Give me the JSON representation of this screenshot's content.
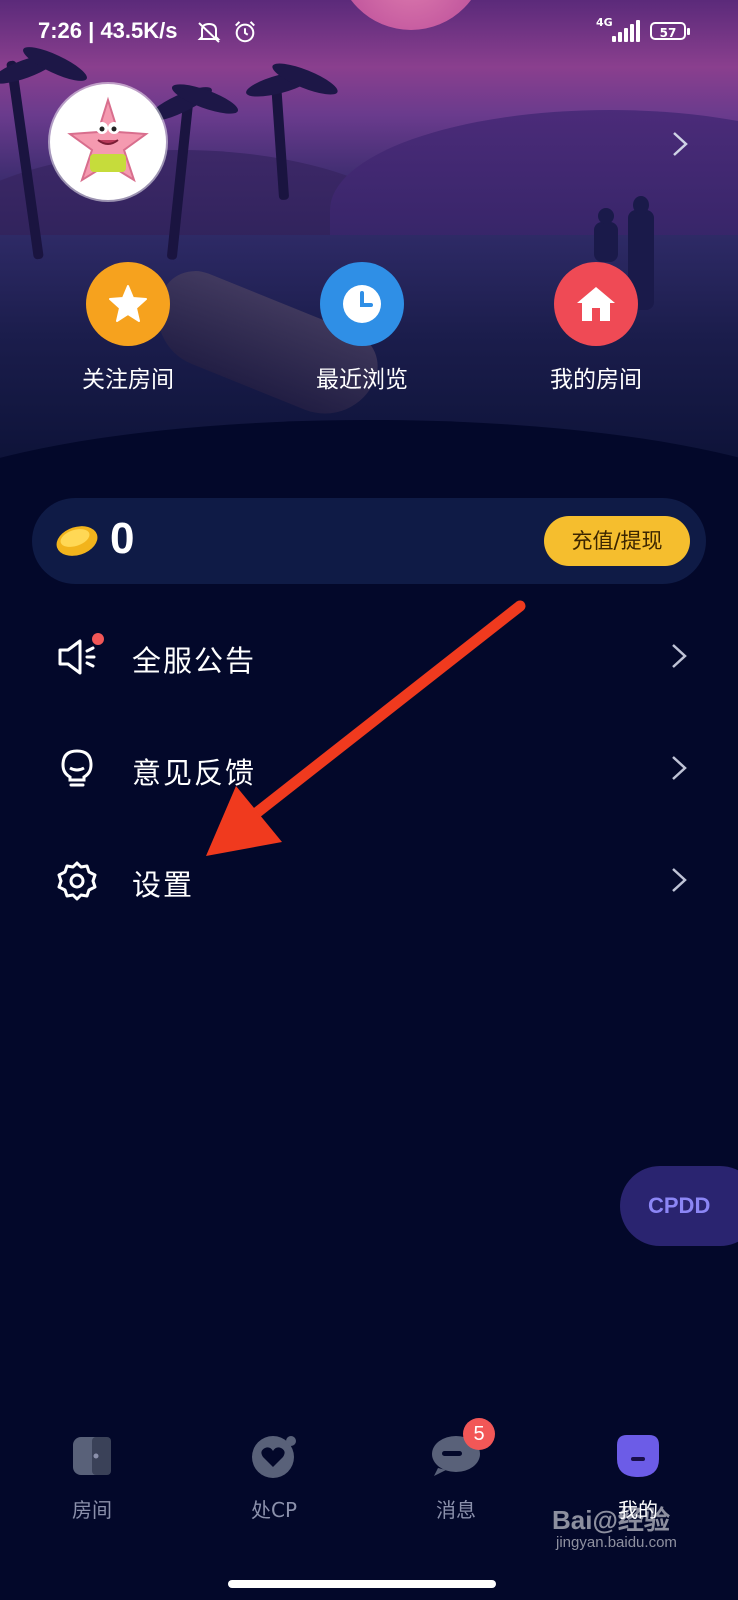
{
  "status_bar": {
    "time": "7:26",
    "speed": "| 43.5K/s",
    "network": "4G",
    "battery": "57"
  },
  "quick_actions": [
    {
      "label": "关注房间",
      "icon": "star-icon",
      "color": "#f6a21e"
    },
    {
      "label": "最近浏览",
      "icon": "clock-icon",
      "color": "#2f8fe6"
    },
    {
      "label": "我的房间",
      "icon": "house-icon",
      "color": "#ef4a55"
    }
  ],
  "wallet": {
    "balance": "0",
    "recharge_label": "充值/提现"
  },
  "menu": [
    {
      "label": "全服公告",
      "icon": "speaker-icon"
    },
    {
      "label": "意见反馈",
      "icon": "lightbulb-icon"
    },
    {
      "label": "设置",
      "icon": "gear-icon"
    }
  ],
  "floating_button": "CPDD",
  "bottom_nav": [
    {
      "label": "房间",
      "icon": "room-icon"
    },
    {
      "label": "处CP",
      "icon": "heart-icon"
    },
    {
      "label": "消息",
      "icon": "chat-icon",
      "badge": "5"
    },
    {
      "label": "我的",
      "icon": "profile-face-icon",
      "active": true
    }
  ],
  "watermark": {
    "brand": "Bai@经验",
    "url": "jingyan.baidu.com"
  },
  "colors": {
    "background": "#03082a",
    "accent_yellow": "#f5be2e",
    "badge_red": "#f25757",
    "active_tab": "#6c5ce7"
  }
}
